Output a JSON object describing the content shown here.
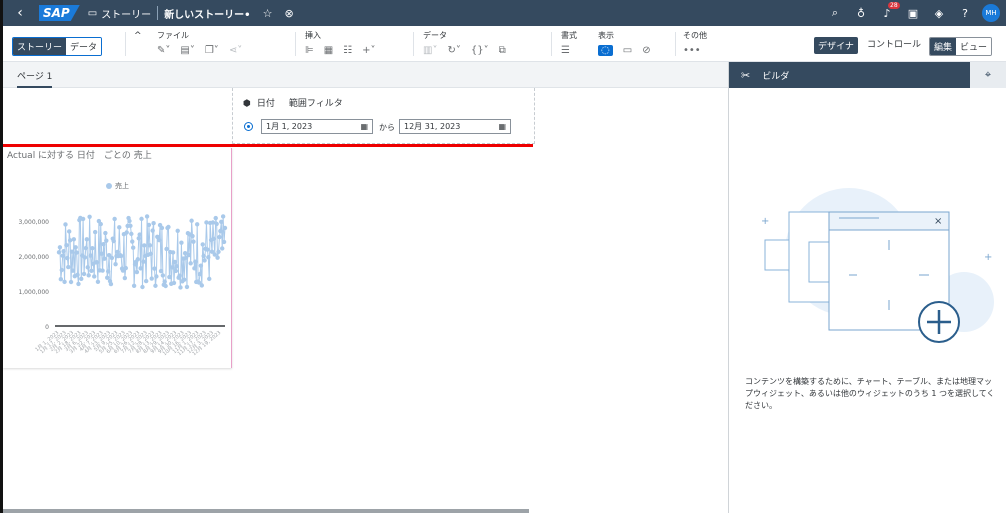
{
  "shell": {
    "logo": "SAP",
    "story_label": "ストーリー",
    "doc_title": "新しいストーリー•",
    "notification_count": "28",
    "avatar": "MH"
  },
  "toolbar": {
    "story_tab": "ストーリー",
    "data_tab": "データ",
    "file_label": "ファイル",
    "insert_label": "挿入",
    "data_label": "データ",
    "format_label": "書式",
    "view_label": "表示",
    "more_label": "その他",
    "designer": "デザイナ",
    "control": "コントロール",
    "edit": "編集",
    "view": "ビュー"
  },
  "page": {
    "tab": "ページ 1"
  },
  "filter": {
    "title_date": "日付",
    "title_range": "範囲フィルタ",
    "from_value": "1月 1, 2023",
    "kara": "から",
    "to_value": "12月 31, 2023"
  },
  "chart": {
    "title": "Actual に対する 日付　ごとの 売上",
    "legend": "売上",
    "series_color": "#a9c9ea",
    "y_ticks": [
      "3,000,000",
      "2,000,000",
      "1,000,000",
      "0"
    ],
    "x_ticks": [
      "1月 1, 2023",
      "1月 17, 2023",
      "2月 2, 2023",
      "2月 18, 2023",
      "3月 6, 2023",
      "3月 22, 2023",
      "4月 7, 2023",
      "4月 23, 2023",
      "5月 9, 2023",
      "5月 25, 2023",
      "6月 10, 2023",
      "6月 26, 2023",
      "7月 12, 2023",
      "7月 28, 2023",
      "8月 13, 2023",
      "8月 29, 2023",
      "9月 14, 2023",
      "9月 30, 2023",
      "10月 16, 2023",
      "11月 1, 2023",
      "11月 17, 2023",
      "12月 3, 2023",
      "12月 19, 2023"
    ]
  },
  "chart_data": {
    "type": "line",
    "title": "Actual に対する 日付　ごとの 売上",
    "series": [
      {
        "name": "売上",
        "min": 1100000,
        "max": 3150000
      }
    ],
    "ylim": [
      0,
      3000000
    ],
    "legend": "top-center"
  },
  "panel": {
    "title": "ビルダ",
    "message": "コンテンツを構築するために、チャート、テーブル、または地理マップウィジェット、あるいは他のウィジェットのうち 1 つを選択してください。"
  }
}
